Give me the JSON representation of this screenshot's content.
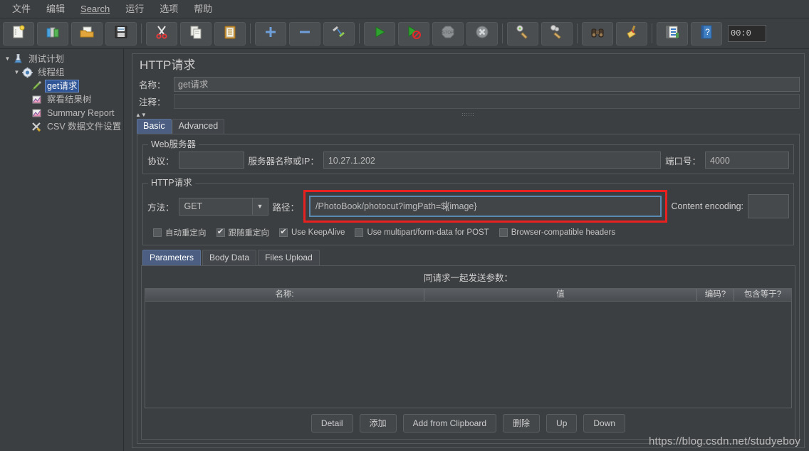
{
  "menubar": {
    "items": [
      {
        "label": "文件",
        "underlined": false
      },
      {
        "label": "编辑",
        "underlined": false
      },
      {
        "label": "Search",
        "underlined": true
      },
      {
        "label": "运行",
        "underlined": false
      },
      {
        "label": "选项",
        "underlined": false
      },
      {
        "label": "帮助",
        "underlined": false
      }
    ]
  },
  "toolbar": {
    "buttons": [
      {
        "icon": "new-document-icon"
      },
      {
        "icon": "open-templates-icon"
      },
      {
        "icon": "open-folder-icon"
      },
      {
        "icon": "save-floppy-icon"
      },
      {
        "icon": "cut-scissors-icon"
      },
      {
        "icon": "copy-icon"
      },
      {
        "icon": "paste-clipboard-icon"
      },
      {
        "icon": "expand-plus-icon"
      },
      {
        "icon": "collapse-minus-icon"
      },
      {
        "icon": "toggle-enable-icon"
      },
      {
        "icon": "start-play-icon"
      },
      {
        "icon": "start-no-pauses-icon"
      },
      {
        "icon": "stop-icon"
      },
      {
        "icon": "shutdown-icon"
      },
      {
        "icon": "clear-icon"
      },
      {
        "icon": "clear-all-icon"
      },
      {
        "icon": "search-binoculars-icon"
      },
      {
        "icon": "reset-search-broom-icon"
      },
      {
        "icon": "function-helper-icon"
      },
      {
        "icon": "help-book-icon"
      }
    ],
    "timer_value": "00:0"
  },
  "tree": {
    "items": [
      {
        "label": "测试计划",
        "icon": "test-plan-icon",
        "depth": 0,
        "twisty": "▼",
        "selected": false
      },
      {
        "label": "线程组",
        "icon": "thread-group-gear-icon",
        "depth": 1,
        "twisty": "▼",
        "selected": false
      },
      {
        "label": "get请求",
        "icon": "http-request-pen-icon",
        "depth": 2,
        "twisty": "",
        "selected": true
      },
      {
        "label": "察看结果树",
        "icon": "view-results-tree-icon",
        "depth": 2,
        "twisty": "",
        "selected": false
      },
      {
        "label": "Summary Report",
        "icon": "summary-report-icon",
        "depth": 2,
        "twisty": "",
        "selected": false
      },
      {
        "label": "CSV 数据文件设置",
        "icon": "csv-data-set-icon",
        "depth": 2,
        "twisty": "",
        "selected": false
      }
    ]
  },
  "request_panel": {
    "title": "HTTP请求",
    "name_label": "名称：",
    "name_value": "get请求",
    "comment_label": "注释：",
    "comment_value": "",
    "tabs": [
      {
        "label": "Basic",
        "active": true
      },
      {
        "label": "Advanced",
        "active": false
      }
    ],
    "web_server": {
      "group_title": "Web服务器",
      "protocol_label": "协议：",
      "protocol_value": "",
      "server_label": "服务器名称或IP：",
      "server_value": "10.27.1.202",
      "port_label": "端口号：",
      "port_value": "4000"
    },
    "http_request": {
      "group_title": "HTTP请求",
      "method_label": "方法：",
      "method_value": "GET",
      "method_arrow": "▼",
      "path_label": "路径：",
      "path_value": "/PhotoBook/photocut?imgPath=$",
      "path_value_tail": "{image}",
      "content_encoding_label": "Content encoding:",
      "content_encoding_value": "",
      "checkboxes": [
        {
          "label": "自动重定向",
          "checked": false
        },
        {
          "label": "跟随重定向",
          "checked": true
        },
        {
          "label": "Use KeepAlive",
          "checked": true
        },
        {
          "label": "Use multipart/form-data for POST",
          "checked": false
        },
        {
          "label": "Browser-compatible headers",
          "checked": false
        }
      ]
    },
    "param_tabs": [
      {
        "label": "Parameters",
        "active": true
      },
      {
        "label": "Body Data",
        "active": false
      },
      {
        "label": "Files Upload",
        "active": false
      }
    ],
    "params": {
      "caption": "同请求一起发送参数：",
      "columns": [
        "名称:",
        "值",
        "编码?",
        "包含等于?"
      ],
      "rows": [],
      "buttons": [
        "Detail",
        "添加",
        "Add from Clipboard",
        "删除",
        "Up",
        "Down"
      ]
    }
  },
  "watermark": "https://blog.csdn.net/studyeboy",
  "colors": {
    "window_bg": "#3c3f41",
    "accent_tab": "#4c5f83",
    "selection": "#2f5597",
    "highlight_border": "#e8201f",
    "focus_border": "#5a8ab0",
    "text": "#cfcfcf"
  }
}
